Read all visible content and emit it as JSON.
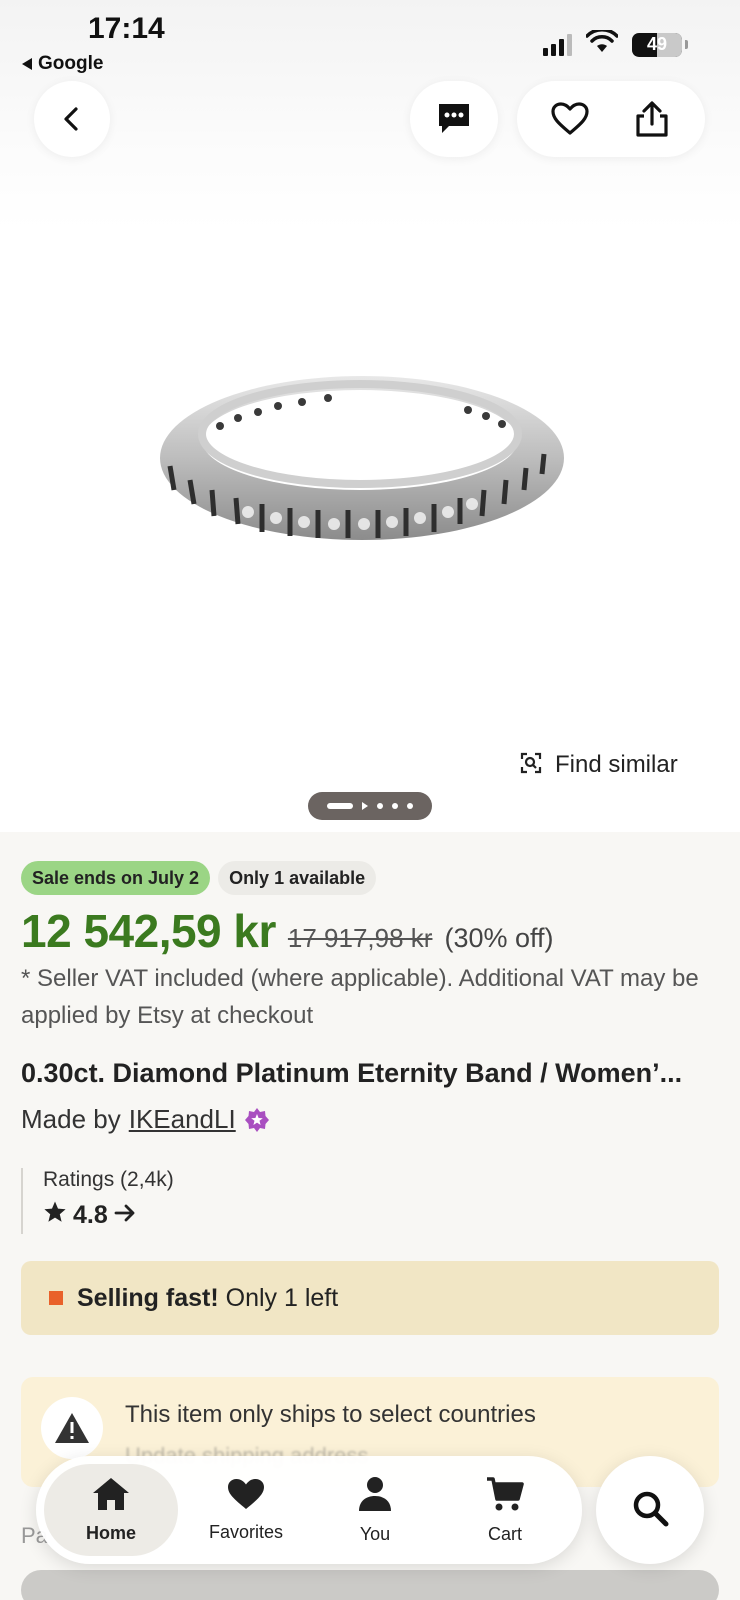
{
  "status_bar": {
    "time": "17:14",
    "back_app": "Google",
    "battery": "49"
  },
  "header": {
    "back_icon": "chevron-left-icon",
    "message_icon": "chat-bubble-icon",
    "favorite_icon": "heart-outline-icon",
    "share_icon": "share-icon"
  },
  "image": {
    "find_similar_label": "Find similar",
    "page_indicator": {
      "current": 1,
      "total": 5
    }
  },
  "listing": {
    "badge_sale": "Sale ends on July 2",
    "badge_availability": "Only 1 available",
    "price_current": "12 542,59 kr",
    "price_original": "17 917,98 kr",
    "price_discount": "(30% off)",
    "vat_note": "* Seller VAT included (where applicable). Additional VAT may be applied by Etsy at checkout",
    "title": "0.30ct. Diamond Platinum Eternity Band / Women’...",
    "made_by_prefix": "Made by",
    "shop_name": "IKEandLI",
    "ratings_label": "Ratings (2,4k)",
    "rating_value": "4.8",
    "selling_fast_bold": "Selling fast!",
    "selling_fast_rest": "Only 1 left",
    "ships_notice": "This item only ships to select countries",
    "ships_sub": "Update shipping address",
    "partial_text": "Pa"
  },
  "tabbar": {
    "items": [
      {
        "label": "Home",
        "icon": "home-icon",
        "active": true
      },
      {
        "label": "Favorites",
        "icon": "heart-filled-icon",
        "active": false
      },
      {
        "label": "You",
        "icon": "person-icon",
        "active": false
      },
      {
        "label": "Cart",
        "icon": "cart-icon",
        "active": false
      }
    ],
    "search_icon": "search-icon"
  },
  "colors": {
    "price_green": "#3b7a1f",
    "sale_badge": "#9bd585",
    "selling_fast_bg": "#f1e6c5",
    "selling_fast_marker": "#e9612a",
    "star_seller": "#a94fc0"
  }
}
